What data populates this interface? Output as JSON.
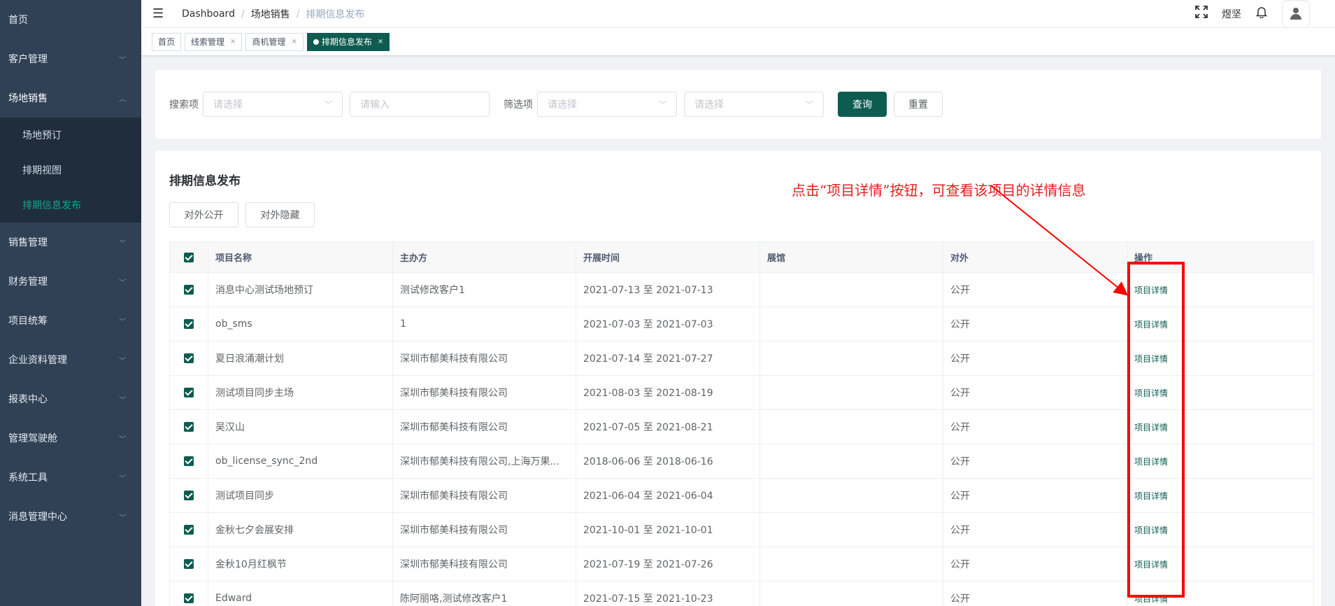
{
  "sidebar": {
    "items": [
      {
        "label": "首页",
        "expandable": false
      },
      {
        "label": "客户管理",
        "expandable": true
      },
      {
        "label": "场地销售",
        "expandable": true,
        "open": true,
        "children": [
          {
            "label": "场地预订"
          },
          {
            "label": "排期视图"
          },
          {
            "label": "排期信息发布",
            "active": true
          }
        ]
      },
      {
        "label": "销售管理",
        "expandable": true
      },
      {
        "label": "财务管理",
        "expandable": true
      },
      {
        "label": "项目统筹",
        "expandable": true
      },
      {
        "label": "企业资料管理",
        "expandable": true
      },
      {
        "label": "报表中心",
        "expandable": true
      },
      {
        "label": "管理驾驶舱",
        "expandable": true
      },
      {
        "label": "系统工具",
        "expandable": true
      },
      {
        "label": "消息管理中心",
        "expandable": true
      }
    ]
  },
  "navbar": {
    "breadcrumb": [
      "Dashboard",
      "场地销售",
      "排期信息发布"
    ],
    "username": "煜坚",
    "icons": [
      "menu-fold-icon",
      "fullscreen-icon",
      "bell-icon",
      "user-icon"
    ]
  },
  "tags": [
    {
      "label": "首页",
      "closable": false,
      "active": false
    },
    {
      "label": "线索管理",
      "closable": true,
      "active": false
    },
    {
      "label": "商机管理",
      "closable": true,
      "active": false
    },
    {
      "label": "排期信息发布",
      "closable": true,
      "active": true
    }
  ],
  "filter": {
    "search_label": "搜索项",
    "search_select_placeholder": "请选择",
    "search_input_placeholder": "请输入",
    "filter_label": "筛选项",
    "filter_select1_placeholder": "请选择",
    "filter_select2_placeholder": "请选择",
    "query_button": "查询",
    "reset_button": "重置"
  },
  "section": {
    "title": "排期信息发布",
    "public_button": "对外公开",
    "hide_button": "对外隐藏"
  },
  "table": {
    "columns": [
      "项目名称",
      "主办方",
      "开展时间",
      "展馆",
      "对外",
      "操作"
    ],
    "rows": [
      {
        "name": "消息中心测试场地预订",
        "organizer": "测试修改客户1",
        "time": "2021-07-13 至 2021-07-13",
        "hall": "",
        "public": "公开",
        "action": "项目详情"
      },
      {
        "name": "ob_sms",
        "organizer": "1",
        "time": "2021-07-03 至 2021-07-03",
        "hall": "",
        "public": "公开",
        "action": "项目详情"
      },
      {
        "name": "夏日浪涌潮计划",
        "organizer": "深圳市郁美科技有限公司",
        "time": "2021-07-14 至 2021-07-27",
        "hall": "",
        "public": "公开",
        "action": "项目详情"
      },
      {
        "name": "测试项目同步主场",
        "organizer": "深圳市郁美科技有限公司",
        "time": "2021-08-03 至 2021-08-19",
        "hall": "",
        "public": "公开",
        "action": "项目详情"
      },
      {
        "name": "吴汉山",
        "organizer": "深圳市郁美科技有限公司",
        "time": "2021-07-05 至 2021-08-21",
        "hall": "",
        "public": "公开",
        "action": "项目详情"
      },
      {
        "name": "ob_license_sync_2nd",
        "organizer": "深圳市郁美科技有限公司,上海万果...",
        "time": "2018-06-06 至 2018-06-16",
        "hall": "",
        "public": "公开",
        "action": "项目详情"
      },
      {
        "name": "测试项目同步",
        "organizer": "深圳市郁美科技有限公司",
        "time": "2021-06-04 至 2021-06-04",
        "hall": "",
        "public": "公开",
        "action": "项目详情"
      },
      {
        "name": "金秋七夕会展安排",
        "organizer": "深圳市郁美科技有限公司",
        "time": "2021-10-01 至 2021-10-01",
        "hall": "",
        "public": "公开",
        "action": "项目详情"
      },
      {
        "name": "金秋10月红枫节",
        "organizer": "深圳市郁美科技有限公司",
        "time": "2021-07-19 至 2021-07-26",
        "hall": "",
        "public": "公开",
        "action": "项目详情"
      },
      {
        "name": "Edward",
        "organizer": "陈阿丽咯,测试修改客户1",
        "time": "2021-07-15 至 2021-10-23",
        "hall": "",
        "public": "公开",
        "action": "项目详情"
      }
    ]
  },
  "annotation": {
    "text": "点击“项目详情”按钮，可查看该项目的详情信息",
    "color": "#e02020"
  },
  "colors": {
    "accent": "#0e5c50",
    "sidebar_bg": "#304156",
    "submenu_bg": "#1f2d3d",
    "active_menu": "#1aa38a"
  }
}
